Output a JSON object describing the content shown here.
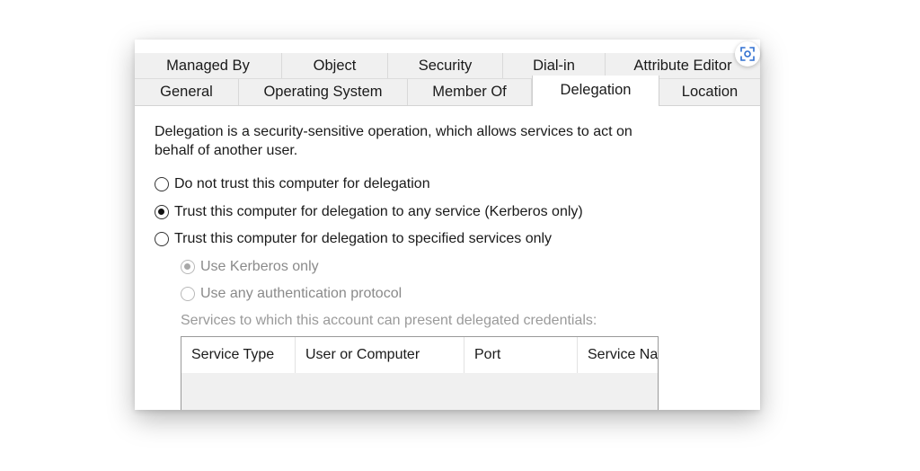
{
  "tabs_back": [
    {
      "label": "Managed By",
      "width": 164
    },
    {
      "label": "Object",
      "width": 118
    },
    {
      "label": "Security",
      "width": 128
    },
    {
      "label": "Dial-in",
      "width": 114
    },
    {
      "label": "Attribute Editor",
      "width": 172
    }
  ],
  "tabs_front": [
    {
      "label": "General",
      "width": 116
    },
    {
      "label": "Operating System",
      "width": 188
    },
    {
      "label": "Member Of",
      "width": 138
    },
    {
      "label": "Delegation",
      "width": 142,
      "active": true
    },
    {
      "label": "Location",
      "width": 112
    }
  ],
  "panel": {
    "description": "Delegation is a security-sensitive operation, which allows services to act on behalf of another user.",
    "options": {
      "no_trust": "Do not trust this computer for delegation",
      "any_service": "Trust this computer for delegation to any service (Kerberos only)",
      "specified": "Trust this computer for delegation to specified services only"
    },
    "sub_options": {
      "kerberos_only": "Use Kerberos only",
      "any_protocol": "Use any authentication protocol"
    },
    "services_label": "Services to which this account can present delegated credentials:",
    "columns": [
      "Service Type",
      "User or Computer",
      "Port",
      "Service Na"
    ]
  },
  "colors": {
    "tab_background": "#f0f0f0",
    "disabled_text": "#8a8a8a"
  },
  "icons": {
    "corner": "screen-capture-icon"
  }
}
